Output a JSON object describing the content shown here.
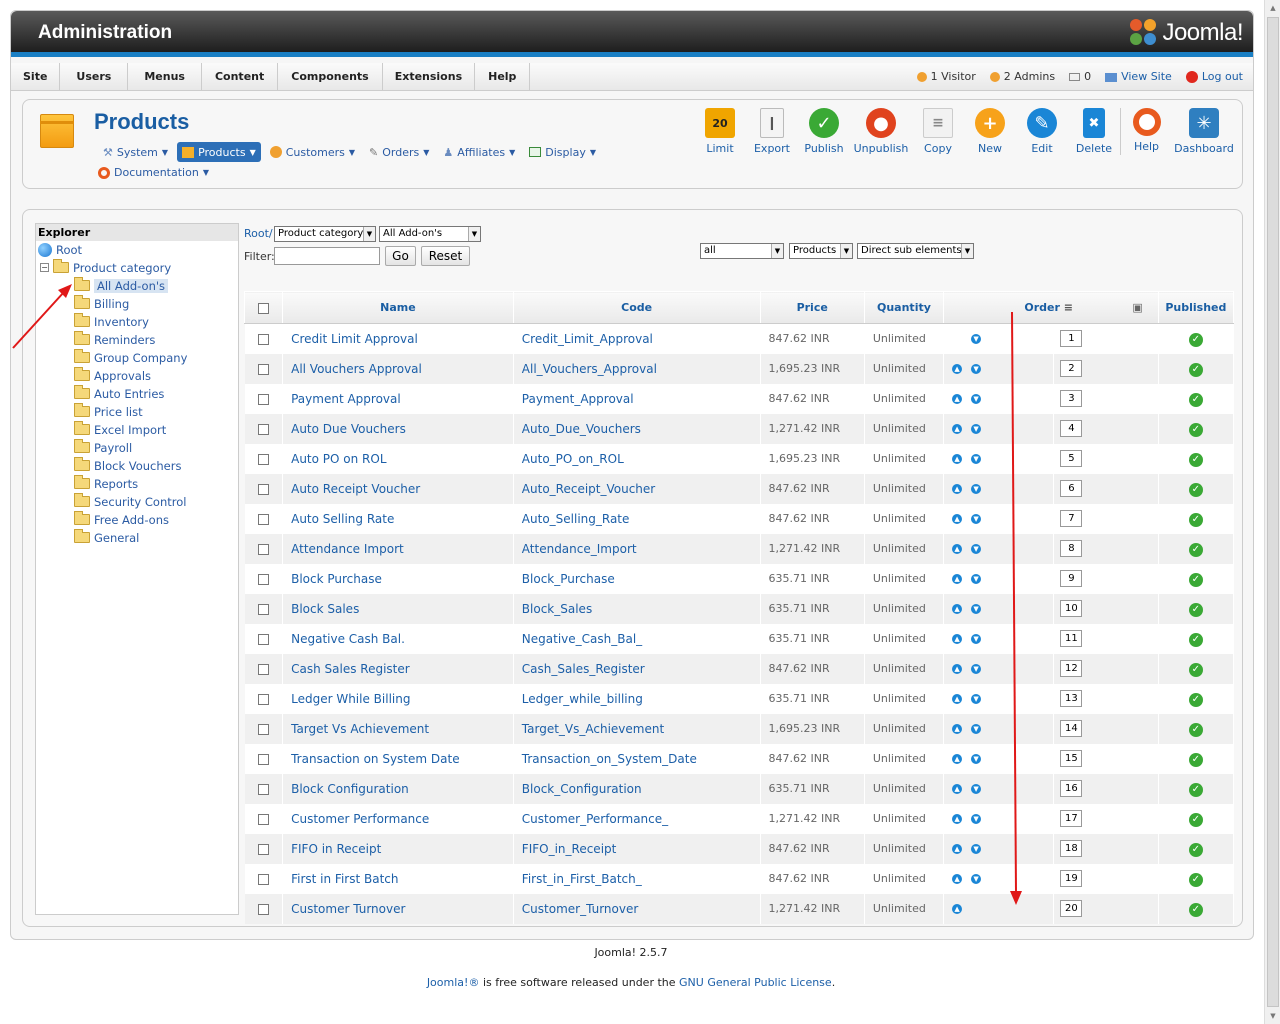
{
  "header": {
    "title": "Administration",
    "logo_text": "Joomla!"
  },
  "menu": [
    "Site",
    "Users",
    "Menus",
    "Content",
    "Components",
    "Extensions",
    "Help"
  ],
  "status": {
    "visitor": "1 Visitor",
    "admins": "2 Admins",
    "messages": "0",
    "view_site": "View Site",
    "logout": "Log out"
  },
  "page": {
    "title": "Products",
    "submenu": [
      {
        "label": "System",
        "icon": "wrench-icon"
      },
      {
        "label": "Products",
        "icon": "box-icon",
        "active": true
      },
      {
        "label": "Customers",
        "icon": "users-icon"
      },
      {
        "label": "Orders",
        "icon": "orders-icon"
      },
      {
        "label": "Affiliates",
        "icon": "affiliates-icon"
      },
      {
        "label": "Display",
        "icon": "display-icon"
      }
    ],
    "documentation": "Documentation"
  },
  "toolbar": [
    {
      "label": "Limit",
      "color": "#f0a500"
    },
    {
      "label": "Export",
      "color": "#e0e0e0"
    },
    {
      "label": "Publish",
      "color": "#3aa935"
    },
    {
      "label": "Unpublish",
      "color": "#e0431e"
    },
    {
      "label": "Copy",
      "color": "#dcdcdc"
    },
    {
      "label": "New",
      "color": "#f7a21a"
    },
    {
      "label": "Edit",
      "color": "#1a86d6"
    },
    {
      "label": "Delete",
      "color": "#1a86d6"
    },
    {
      "label": "Help",
      "color": "#e85a1e"
    },
    {
      "label": "Dashboard",
      "color": "#2f7fc0"
    }
  ],
  "explorer": {
    "title": "Explorer",
    "root": "Root",
    "category": "Product category",
    "items": [
      "All Add-on's",
      "Billing",
      "Inventory",
      "Reminders",
      "Group Company",
      "Approvals",
      "Auto Entries",
      "Price list",
      "Excel Import",
      "Payroll",
      "Block Vouchers",
      "Reports",
      "Security Control",
      "Free Add-ons",
      "General"
    ]
  },
  "filters": {
    "root_label": "Root/",
    "category_select": "Product category",
    "subcategory_select": "All Add-on's",
    "filter_label": "Filter:",
    "go": "Go",
    "reset": "Reset",
    "scope_select": "all",
    "type_select": "Products",
    "depth_select": "Direct sub elements"
  },
  "table": {
    "headers": {
      "name": "Name",
      "code": "Code",
      "price": "Price",
      "quantity": "Quantity",
      "order": "Order",
      "published": "Published"
    },
    "rows": [
      {
        "name": "Credit Limit Approval",
        "code": "Credit_Limit_Approval",
        "price": "847.62 INR",
        "qty": "Unlimited",
        "order": "1"
      },
      {
        "name": "All Vouchers Approval",
        "code": "All_Vouchers_Approval",
        "price": "1,695.23 INR",
        "qty": "Unlimited",
        "order": "2"
      },
      {
        "name": "Payment Approval",
        "code": "Payment_Approval",
        "price": "847.62 INR",
        "qty": "Unlimited",
        "order": "3"
      },
      {
        "name": "Auto Due Vouchers",
        "code": "Auto_Due_Vouchers",
        "price": "1,271.42 INR",
        "qty": "Unlimited",
        "order": "4"
      },
      {
        "name": "Auto PO on ROL",
        "code": "Auto_PO_on_ROL",
        "price": "1,695.23 INR",
        "qty": "Unlimited",
        "order": "5"
      },
      {
        "name": "Auto Receipt Voucher",
        "code": "Auto_Receipt_Voucher",
        "price": "847.62 INR",
        "qty": "Unlimited",
        "order": "6"
      },
      {
        "name": "Auto Selling Rate",
        "code": "Auto_Selling_Rate",
        "price": "847.62 INR",
        "qty": "Unlimited",
        "order": "7"
      },
      {
        "name": "Attendance Import",
        "code": "Attendance_Import",
        "price": "1,271.42 INR",
        "qty": "Unlimited",
        "order": "8"
      },
      {
        "name": "Block Purchase",
        "code": "Block_Purchase",
        "price": "635.71 INR",
        "qty": "Unlimited",
        "order": "9"
      },
      {
        "name": "Block Sales",
        "code": "Block_Sales",
        "price": "635.71 INR",
        "qty": "Unlimited",
        "order": "10"
      },
      {
        "name": "Negative Cash Bal.",
        "code": "Negative_Cash_Bal_",
        "price": "635.71 INR",
        "qty": "Unlimited",
        "order": "11"
      },
      {
        "name": "Cash Sales Register",
        "code": "Cash_Sales_Register",
        "price": "847.62 INR",
        "qty": "Unlimited",
        "order": "12"
      },
      {
        "name": "Ledger While Billing",
        "code": "Ledger_while_billing",
        "price": "635.71 INR",
        "qty": "Unlimited",
        "order": "13"
      },
      {
        "name": "Target Vs Achievement",
        "code": "Target_Vs_Achievement",
        "price": "1,695.23 INR",
        "qty": "Unlimited",
        "order": "14"
      },
      {
        "name": "Transaction on System Date",
        "code": "Transaction_on_System_Date",
        "price": "847.62 INR",
        "qty": "Unlimited",
        "order": "15"
      },
      {
        "name": "Block Configuration",
        "code": "Block_Configuration",
        "price": "635.71 INR",
        "qty": "Unlimited",
        "order": "16"
      },
      {
        "name": "Customer Performance",
        "code": "Customer_Performance_",
        "price": "1,271.42 INR",
        "qty": "Unlimited",
        "order": "17"
      },
      {
        "name": "FIFO in Receipt",
        "code": "FIFO_in_Receipt",
        "price": "847.62 INR",
        "qty": "Unlimited",
        "order": "18"
      },
      {
        "name": "First in First Batch",
        "code": "First_in_First_Batch_",
        "price": "847.62 INR",
        "qty": "Unlimited",
        "order": "19"
      },
      {
        "name": "Customer Turnover",
        "code": "Customer_Turnover",
        "price": "1,271.42 INR",
        "qty": "Unlimited",
        "order": "20"
      }
    ]
  },
  "footer": {
    "version": "Joomla! 2.5.7",
    "joomla_link": "Joomla!®",
    "middle": " is free software released under the ",
    "license_link": "GNU General Public License",
    "end": "."
  },
  "colors": {
    "accent": "#1a7fc4",
    "link": "#1c5fa8",
    "annotation_arrow": "#e01818"
  }
}
